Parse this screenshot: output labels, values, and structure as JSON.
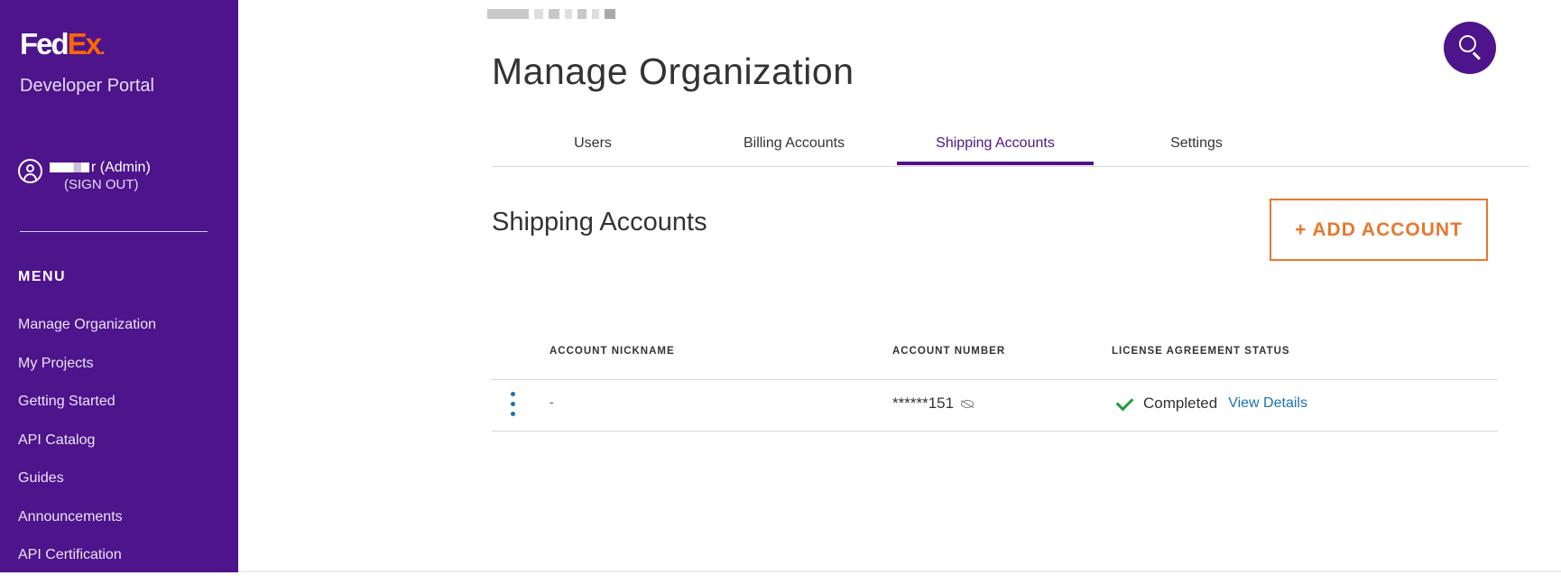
{
  "sidebar": {
    "logo": {
      "fed": "Fed",
      "ex": "Ex",
      "dot": "."
    },
    "portal_name": "Developer Portal",
    "user": {
      "name_suffix": "r (Admin)",
      "sign_out": "(SIGN OUT)"
    },
    "menu_title": "MENU",
    "items": [
      {
        "label": "Manage Organization"
      },
      {
        "label": "My Projects"
      },
      {
        "label": "Getting Started"
      },
      {
        "label": "API Catalog"
      },
      {
        "label": "Guides"
      },
      {
        "label": "Announcements"
      },
      {
        "label": "API Certification"
      }
    ]
  },
  "header": {
    "title": "Manage Organization",
    "search_icon": "search-icon"
  },
  "tabs": [
    {
      "label": "Users",
      "active": false
    },
    {
      "label": "Billing Accounts",
      "active": false
    },
    {
      "label": "Shipping Accounts",
      "active": true
    },
    {
      "label": "Settings",
      "active": false
    }
  ],
  "section": {
    "title": "Shipping Accounts",
    "add_button": "+ ADD ACCOUNT"
  },
  "table": {
    "columns": [
      "ACCOUNT NICKNAME",
      "ACCOUNT NUMBER",
      "LICENSE AGREEMENT STATUS"
    ],
    "rows": [
      {
        "nickname": "-",
        "account_number": "******151",
        "status": "Completed",
        "action": "View Details"
      }
    ]
  },
  "colors": {
    "brand_purple": "#4d148c",
    "accent_orange": "#e8772e",
    "link_blue": "#1a73b4",
    "success_green": "#1e9e3a"
  }
}
